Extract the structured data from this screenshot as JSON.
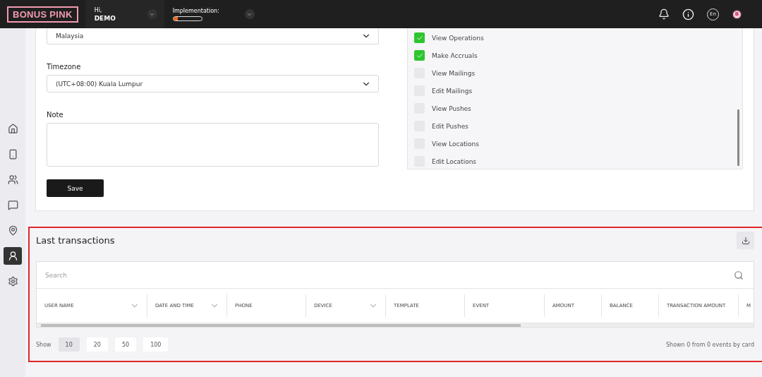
{
  "header": {
    "logo": "BONUS PINK",
    "greeting": "Hi,",
    "user": "DEMO",
    "implementation": {
      "label": "Implementation:",
      "level": 0.17
    },
    "language": "En",
    "avatar": "B"
  },
  "sidebar": {
    "items": [
      {
        "kind": "home",
        "selected": false
      },
      {
        "kind": "device",
        "selected": false
      },
      {
        "kind": "users",
        "selected": false
      },
      {
        "kind": "chat",
        "selected": false
      },
      {
        "kind": "location",
        "selected": false
      },
      {
        "kind": "user",
        "selected": true
      },
      {
        "kind": "settings",
        "selected": false
      }
    ]
  },
  "settings_form": {
    "country": {
      "value": "Malaysia"
    },
    "timezone": {
      "label": "Timezone",
      "value": "(UTC+08:00) Kuala Lumpur"
    },
    "note": {
      "label": "Note"
    },
    "save_button": "Save",
    "permissions": [
      {
        "label": "View Operations",
        "checked": true
      },
      {
        "label": "Make Accruals",
        "checked": true
      },
      {
        "label": "View Mailings",
        "checked": false
      },
      {
        "label": "Edit Mailings",
        "checked": false
      },
      {
        "label": "View Pushes",
        "checked": false
      },
      {
        "label": "Edit Pushes",
        "checked": false
      },
      {
        "label": "View Locations",
        "checked": false
      },
      {
        "label": "Edit Locations",
        "checked": false
      }
    ]
  },
  "transactions": {
    "title": "Last transactions",
    "search": {
      "placeholder": "Search"
    },
    "columns": [
      {
        "label": "USER NAME",
        "sortable": true
      },
      {
        "label": "DATE AND TIME",
        "sortable": true
      },
      {
        "label": "PHONE",
        "sortable": false
      },
      {
        "label": "DEVICE",
        "sortable": true
      },
      {
        "label": "TEMPLATE",
        "sortable": false
      },
      {
        "label": "EVENT",
        "sortable": false
      },
      {
        "label": "AMOUNT",
        "sortable": false
      },
      {
        "label": "BALANCE",
        "sortable": false
      },
      {
        "label": "TRANSACTION AMOUNT",
        "sortable": false
      },
      {
        "label": "M"
      }
    ],
    "page_size": {
      "label": "Show",
      "options": [
        {
          "label": "10",
          "selected": true
        },
        {
          "label": "20",
          "selected": false
        },
        {
          "label": "50",
          "selected": false
        },
        {
          "label": "100",
          "selected": false
        }
      ]
    },
    "summary": "Shown 0 from 0 events by card"
  }
}
